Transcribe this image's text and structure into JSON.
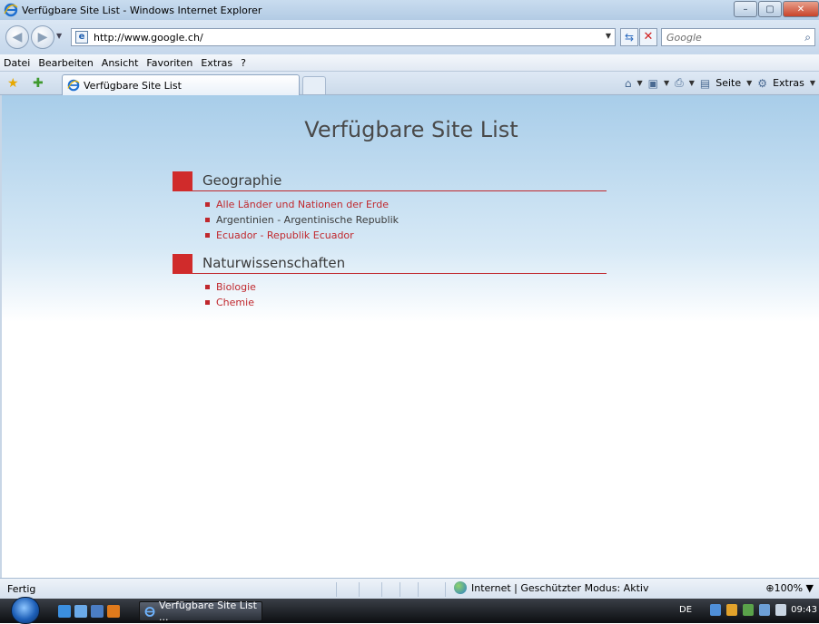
{
  "window": {
    "title": "Verfügbare Site List - Windows Internet Explorer",
    "buttons": {
      "minimize": "–",
      "maximize": "▢",
      "close": "✕"
    }
  },
  "address_bar": {
    "url": "http://www.google.ch/",
    "search_placeholder": "Google",
    "back_icon": "back-arrow-icon",
    "forward_icon": "forward-arrow-icon"
  },
  "menu": {
    "items": [
      "Datei",
      "Bearbeiten",
      "Ansicht",
      "Favoriten",
      "Extras",
      "?"
    ]
  },
  "tabs": {
    "active_label": "Verfügbare Site List",
    "commands": {
      "page_label": "Seite",
      "tools_label": "Extras"
    }
  },
  "page": {
    "title": "Verfügbare Site List",
    "sections": [
      {
        "heading": "Geographie",
        "items": [
          {
            "label": "Alle Länder und Nationen der Erde",
            "link": true
          },
          {
            "label": "Argentinien - Argentinische Republik",
            "link": false
          },
          {
            "label": "Ecuador - Republik Ecuador",
            "link": true
          }
        ]
      },
      {
        "heading": "Naturwissenschaften",
        "items": [
          {
            "label": "Biologie",
            "link": true
          },
          {
            "label": "Chemie",
            "link": true
          }
        ]
      }
    ]
  },
  "status_bar": {
    "status": "Fertig",
    "zone": "Internet | Geschützter Modus: Aktiv",
    "zoom": "100%"
  },
  "taskbar": {
    "task_label": "Verfügbare Site List ...",
    "language": "DE",
    "clock": "09:43"
  },
  "colors": {
    "accent_red": "#d02b2b",
    "link_red": "#c0282d",
    "content_gradient_top": "#a8cde9"
  }
}
